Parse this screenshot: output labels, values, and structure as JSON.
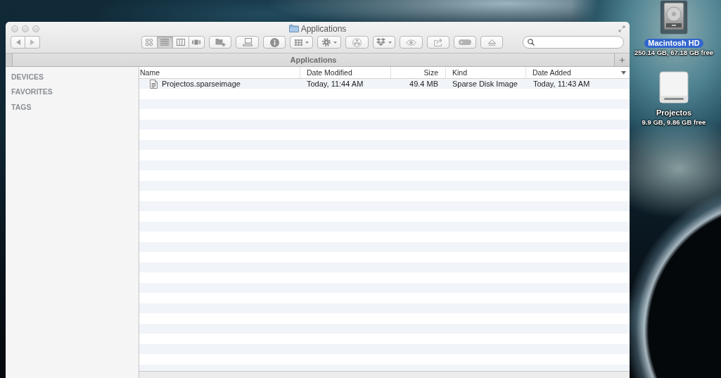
{
  "window": {
    "title": "Applications"
  },
  "toolbar": {
    "view_modes": [
      {
        "kind": "icons",
        "selected": false
      },
      {
        "kind": "list",
        "selected": true
      },
      {
        "kind": "columns",
        "selected": false
      },
      {
        "kind": "cover_flow",
        "selected": false
      }
    ]
  },
  "tab_bar": {
    "tabs": [
      {
        "label": "Applications",
        "selected": true
      }
    ]
  },
  "sidebar": {
    "sections": [
      "DEVICES",
      "FAVORITES",
      "TAGS"
    ]
  },
  "table": {
    "columns": [
      {
        "label": "Name",
        "sorted": false
      },
      {
        "label": "Date Modified",
        "sorted": false
      },
      {
        "label": "Size",
        "sorted": false
      },
      {
        "label": "Kind",
        "sorted": false
      },
      {
        "label": "Date Added",
        "sorted": true
      }
    ],
    "rows": [
      {
        "name": "Projectos.sparseimage",
        "date_modified": "Today, 11:44 AM",
        "size": "49.4 MB",
        "file_kind": "Sparse Disk Image",
        "date_added": "Today, 11:43 AM",
        "selected": false
      }
    ]
  },
  "desktop": {
    "volumes": [
      {
        "kind": "internal",
        "name": "Macintosh HD",
        "info": "250.14 GB, 67.18 GB free",
        "selected": true
      },
      {
        "kind": "external",
        "name": "Projectos",
        "info": "9.9 GB, 9.86 GB free",
        "selected": false
      }
    ]
  }
}
